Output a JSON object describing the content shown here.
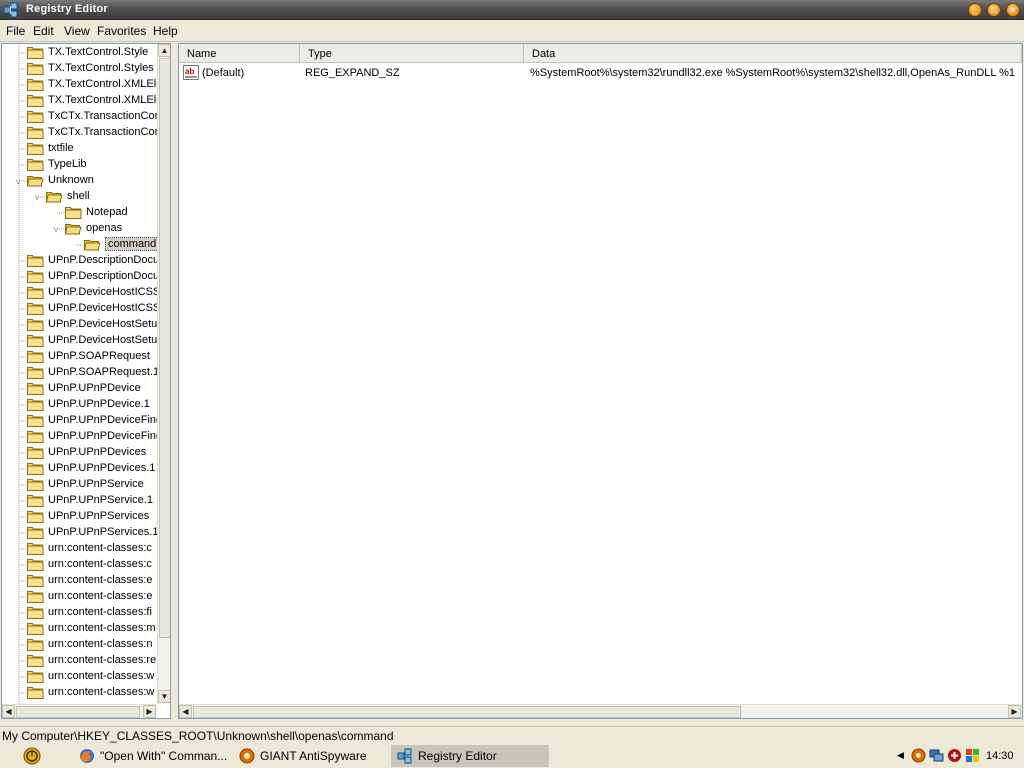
{
  "window": {
    "title": "Registry Editor"
  },
  "menu": [
    "File",
    "Edit",
    "View",
    "Favorites",
    "Help"
  ],
  "tree": [
    {
      "label": "TX.TextControl.Style",
      "depth": 0
    },
    {
      "label": "TX.TextControl.Styles",
      "depth": 0
    },
    {
      "label": "TX.TextControl.XMLEle",
      "depth": 0
    },
    {
      "label": "TX.TextControl.XMLEle",
      "depth": 0
    },
    {
      "label": "TxCTx.TransactionCon",
      "depth": 0
    },
    {
      "label": "TxCTx.TransactionCor",
      "depth": 0
    },
    {
      "label": "txtfile",
      "depth": 0
    },
    {
      "label": "TypeLib",
      "depth": 0
    },
    {
      "label": "Unknown",
      "depth": 0,
      "expanded": true
    },
    {
      "label": "shell",
      "depth": 1,
      "expanded": true
    },
    {
      "label": "Notepad",
      "depth": 2
    },
    {
      "label": "openas",
      "depth": 2,
      "expanded": true
    },
    {
      "label": "command",
      "depth": 3,
      "selected": true
    },
    {
      "label": "UPnP.DescriptionDocu",
      "depth": 0
    },
    {
      "label": "UPnP.DescriptionDocu",
      "depth": 0
    },
    {
      "label": "UPnP.DeviceHostICSS",
      "depth": 0
    },
    {
      "label": "UPnP.DeviceHostICSS",
      "depth": 0
    },
    {
      "label": "UPnP.DeviceHostSetup",
      "depth": 0
    },
    {
      "label": "UPnP.DeviceHostSetup",
      "depth": 0
    },
    {
      "label": "UPnP.SOAPRequest",
      "depth": 0
    },
    {
      "label": "UPnP.SOAPRequest.1",
      "depth": 0
    },
    {
      "label": "UPnP.UPnPDevice",
      "depth": 0
    },
    {
      "label": "UPnP.UPnPDevice.1",
      "depth": 0
    },
    {
      "label": "UPnP.UPnPDeviceFinde",
      "depth": 0
    },
    {
      "label": "UPnP.UPnPDeviceFinde",
      "depth": 0
    },
    {
      "label": "UPnP.UPnPDevices",
      "depth": 0
    },
    {
      "label": "UPnP.UPnPDevices.1",
      "depth": 0
    },
    {
      "label": "UPnP.UPnPService",
      "depth": 0
    },
    {
      "label": "UPnP.UPnPService.1",
      "depth": 0
    },
    {
      "label": "UPnP.UPnPServices",
      "depth": 0
    },
    {
      "label": "UPnP.UPnPServices.1",
      "depth": 0
    },
    {
      "label": "urn:content-classes:c",
      "depth": 0
    },
    {
      "label": "urn:content-classes:c",
      "depth": 0
    },
    {
      "label": "urn:content-classes:e",
      "depth": 0
    },
    {
      "label": "urn:content-classes:e",
      "depth": 0
    },
    {
      "label": "urn:content-classes:fi",
      "depth": 0
    },
    {
      "label": "urn:content-classes:m",
      "depth": 0
    },
    {
      "label": "urn:content-classes:n",
      "depth": 0
    },
    {
      "label": "urn:content-classes:re",
      "depth": 0
    },
    {
      "label": "urn:content-classes:w",
      "depth": 0
    },
    {
      "label": "urn:content-classes:w",
      "depth": 0
    }
  ],
  "list": {
    "columns": [
      "Name",
      "Type",
      "Data"
    ],
    "rows": [
      {
        "name": "(Default)",
        "type": "REG_EXPAND_SZ",
        "data": "%SystemRoot%\\system32\\rundll32.exe %SystemRoot%\\system32\\shell32.dll,OpenAs_RunDLL %1"
      }
    ]
  },
  "status": "My Computer\\HKEY_CLASSES_ROOT\\Unknown\\shell\\openas\\command",
  "taskbar": {
    "items": [
      {
        "label": "\"Open With\" Comman...",
        "icon": "firefox-icon",
        "active": false
      },
      {
        "label": "GIANT AntiSpyware",
        "icon": "antispyware-icon",
        "active": false
      },
      {
        "label": "Registry Editor",
        "icon": "regedit-icon",
        "active": true
      }
    ],
    "clock": "14:30"
  },
  "colors": {
    "folder": "#f5d66b",
    "titlebar": "#4d4d4d",
    "selection": "#d4d0c8"
  }
}
